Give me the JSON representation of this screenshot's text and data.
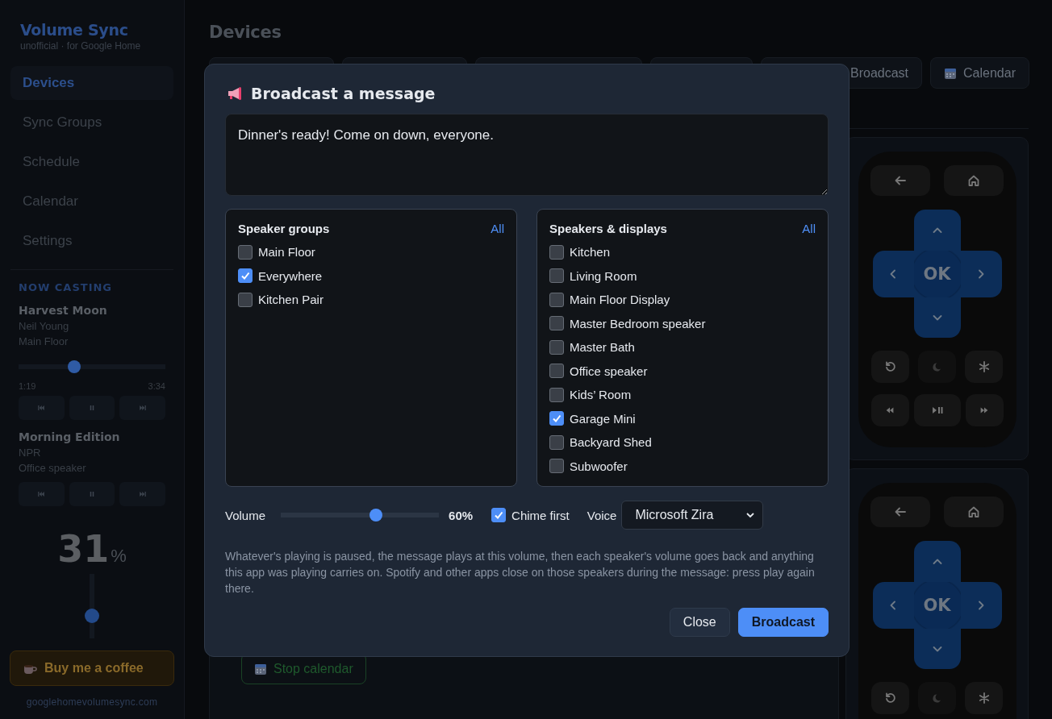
{
  "sidebar": {
    "brand": "Volume Sync",
    "tagline": "unofficial · for Google Home",
    "nav": [
      {
        "label": "Devices",
        "selected": true
      },
      {
        "label": "Sync Groups",
        "selected": false
      },
      {
        "label": "Schedule",
        "selected": false
      },
      {
        "label": "Calendar",
        "selected": false
      },
      {
        "label": "Settings",
        "selected": false
      }
    ],
    "now_casting": {
      "heading": "NOW CASTING",
      "items": [
        {
          "title": "Harvest Moon",
          "artist": "Neil Young",
          "device": "Main Floor",
          "progress": {
            "level": 0.38,
            "elapsed": "1:19",
            "total": "3:34"
          }
        },
        {
          "title": "Morning Edition",
          "artist": "NPR",
          "device": "Office speaker"
        }
      ]
    },
    "volume": {
      "value": "31",
      "unit": "%",
      "level": 0.31
    },
    "coffee_button": "Buy me a coffee",
    "site": "googlehomevolumesync.com"
  },
  "main": {
    "title": "Devices",
    "toolbar": [
      {
        "label": "Broadcast",
        "kind": "plain"
      },
      {
        "label": "Calendar",
        "kind": "calendar"
      }
    ],
    "stop_calendar_button": "Stop calendar",
    "remotes": [
      {
        "ok_label": "OK",
        "kind": "full"
      },
      {
        "ok_label": "OK",
        "kind": "cut"
      }
    ]
  },
  "dialog": {
    "title": "Broadcast a message",
    "message": "Dinner's ready! Come on down, everyone.",
    "panels": [
      {
        "heading": "Speaker groups",
        "all_link": "All",
        "items": [
          {
            "label": "Main Floor",
            "checked": false
          },
          {
            "label": "Everywhere",
            "checked": true
          },
          {
            "label": "Kitchen Pair",
            "checked": false
          }
        ]
      },
      {
        "heading": "Speakers & displays",
        "all_link": "All",
        "items": [
          {
            "label": "Kitchen",
            "checked": false
          },
          {
            "label": "Living Room",
            "checked": false
          },
          {
            "label": "Main Floor Display",
            "checked": false
          },
          {
            "label": "Master Bedroom speaker",
            "checked": false
          },
          {
            "label": "Master Bath",
            "checked": false
          },
          {
            "label": "Office speaker",
            "checked": false
          },
          {
            "label": "Kids’ Room",
            "checked": false
          },
          {
            "label": "Garage Mini",
            "checked": true
          },
          {
            "label": "Backyard Shed",
            "checked": false
          },
          {
            "label": "Subwoofer",
            "checked": false
          }
        ]
      }
    ],
    "volume": {
      "label": "Volume",
      "level": 0.6,
      "reading": "60%"
    },
    "chime": {
      "label": "Chime first",
      "checked": true
    },
    "voice": {
      "label": "Voice",
      "value": "Microsoft Zira"
    },
    "note": "Whatever's playing is paused, the message plays at this volume, then each speaker's volume goes back and anything this app was playing carries on. Spotify and other apps close on those speakers during the message: press play again there.",
    "buttons": [
      {
        "label": "Close",
        "kind": "secondary"
      },
      {
        "label": "Broadcast",
        "kind": "primary"
      }
    ]
  }
}
